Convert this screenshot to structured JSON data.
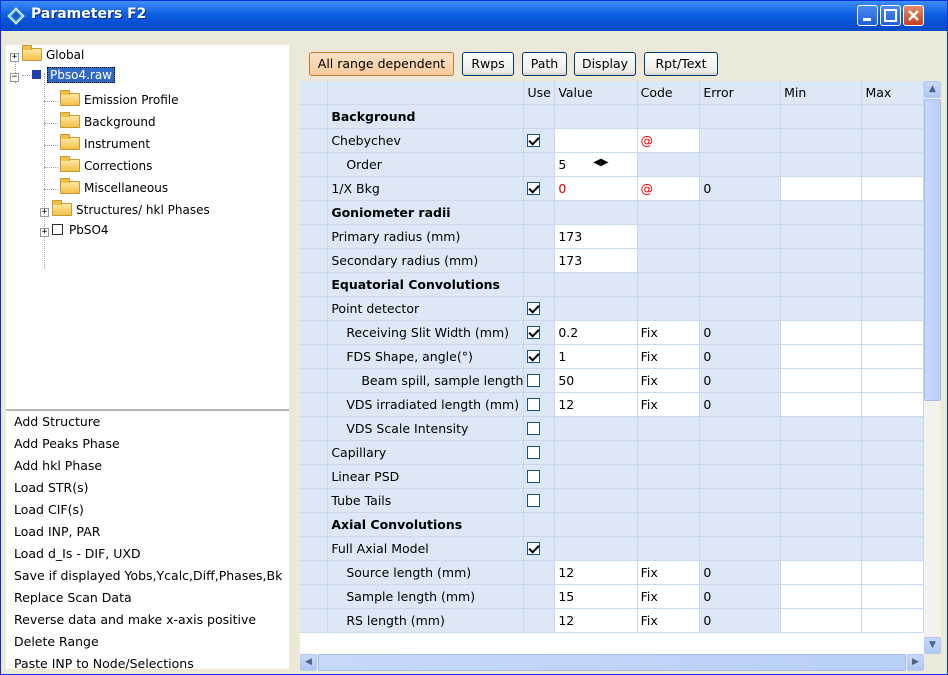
{
  "window": {
    "title": "Parameters F2"
  },
  "tree": {
    "global": "Global",
    "file": "Pbso4.raw",
    "children": [
      "Emission Profile",
      "Background",
      "Instrument",
      "Corrections",
      "Miscellaneous",
      "Structures/ hkl Phases",
      "PbSO4"
    ]
  },
  "commands": [
    "Add Structure",
    "Add Peaks Phase",
    "Add hkl Phase",
    "Load STR(s)",
    "Load CIF(s)",
    "Load INP, PAR",
    "Load d_Is - DIF, UXD",
    "Save if displayed Yobs,Ycalc,Diff,Phases,Bkg",
    "Replace Scan Data",
    "Reverse data and make x-axis positive",
    "Delete Range",
    "Paste INP to Node/Selections"
  ],
  "toolbar": {
    "all_range": "All range dependent",
    "rwps": "Rwps",
    "path": "Path",
    "display": "Display",
    "rpt": "Rpt/Text"
  },
  "columns": {
    "use": "Use",
    "value": "Value",
    "code": "Code",
    "error": "Error",
    "min": "Min",
    "max": "Max"
  },
  "rows": [
    {
      "name": "Background",
      "section": true
    },
    {
      "name": "Chebychev",
      "use": true,
      "value": "",
      "code": "@",
      "error": ""
    },
    {
      "name": "Order",
      "indent": 1,
      "value": "5"
    },
    {
      "name": "1/X Bkg",
      "use": true,
      "value": "0",
      "code": "@",
      "error": "0",
      "red": true
    },
    {
      "name": "Goniometer radii",
      "section": true
    },
    {
      "name": "Primary radius (mm)",
      "value": "173"
    },
    {
      "name": "Secondary radius (mm)",
      "value": "173"
    },
    {
      "name": "Equatorial Convolutions",
      "section": true
    },
    {
      "name": "Point detector",
      "use": true
    },
    {
      "name": "Receiving Slit Width (mm)",
      "indent": 1,
      "use": true,
      "value": "0.2",
      "code": "Fix",
      "error": "0"
    },
    {
      "name": "FDS Shape, angle(°)",
      "indent": 1,
      "use": true,
      "value": "1",
      "code": "Fix",
      "error": "0"
    },
    {
      "name": "Beam spill, sample length",
      "indent": 2,
      "use": false,
      "value": "50",
      "code": "Fix",
      "error": "0"
    },
    {
      "name": "VDS irradiated length (mm)",
      "indent": 1,
      "use": false,
      "value": "12",
      "code": "Fix",
      "error": "0"
    },
    {
      "name": "VDS Scale Intensity",
      "indent": 1,
      "use": false
    },
    {
      "name": "Capillary",
      "use": false
    },
    {
      "name": "Linear PSD",
      "use": false
    },
    {
      "name": "Tube Tails",
      "use": false
    },
    {
      "name": "Axial Convolutions",
      "section": true
    },
    {
      "name": "Full Axial Model",
      "use": true
    },
    {
      "name": "Source length (mm)",
      "indent": 1,
      "value": "12",
      "code": "Fix",
      "error": "0"
    },
    {
      "name": "Sample length (mm)",
      "indent": 1,
      "value": "15",
      "code": "Fix",
      "error": "0"
    },
    {
      "name": "RS length (mm)",
      "indent": 1,
      "value": "12",
      "code": "Fix",
      "error": "0"
    }
  ]
}
